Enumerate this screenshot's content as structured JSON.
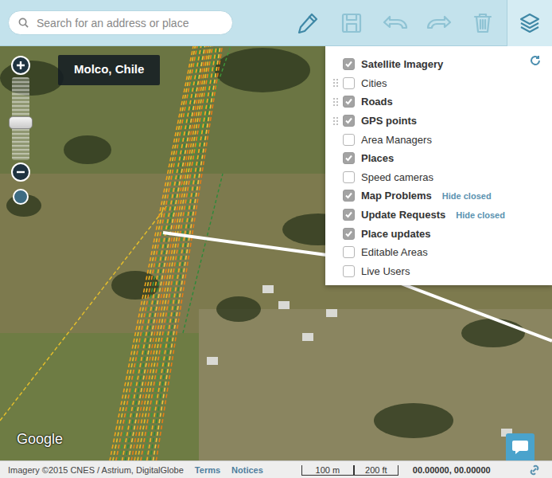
{
  "toolbar": {
    "search_placeholder": "Search for an address or place",
    "tools": [
      {
        "kind": "pencil",
        "disabled": false
      },
      {
        "kind": "save",
        "disabled": true
      },
      {
        "kind": "undo",
        "disabled": true
      },
      {
        "kind": "redo",
        "disabled": true
      },
      {
        "kind": "trash",
        "disabled": true
      }
    ]
  },
  "zoom": {
    "level": 0.45
  },
  "location": "Molco, Chile",
  "layers": {
    "items": [
      {
        "label": "Satellite Imagery",
        "checked": true,
        "draggable": false,
        "action": ""
      },
      {
        "label": "Cities",
        "checked": false,
        "draggable": true,
        "action": ""
      },
      {
        "label": "Roads",
        "checked": true,
        "draggable": true,
        "action": ""
      },
      {
        "label": "GPS points",
        "checked": true,
        "draggable": true,
        "action": ""
      },
      {
        "label": "Area Managers",
        "checked": false,
        "draggable": false,
        "action": ""
      },
      {
        "label": "Places",
        "checked": true,
        "draggable": false,
        "action": ""
      },
      {
        "label": "Speed cameras",
        "checked": false,
        "draggable": false,
        "action": ""
      },
      {
        "label": "Map Problems",
        "checked": true,
        "draggable": false,
        "action": "Hide closed"
      },
      {
        "label": "Update Requests",
        "checked": true,
        "draggable": false,
        "action": "Hide closed"
      },
      {
        "label": "Place updates",
        "checked": true,
        "draggable": false,
        "action": ""
      },
      {
        "label": "Editable Areas",
        "checked": false,
        "draggable": false,
        "action": ""
      },
      {
        "label": "Live Users",
        "checked": false,
        "draggable": false,
        "action": ""
      }
    ]
  },
  "map": {
    "logo": "Google"
  },
  "footer": {
    "imagery": "Imagery ©2015 CNES / Astrium, DigitalGlobe",
    "links": [
      "Terms",
      "Notices"
    ],
    "scale": {
      "metric": "100 m",
      "imperial": "200 ft"
    },
    "coordinates": "00.00000, 00.00000"
  }
}
